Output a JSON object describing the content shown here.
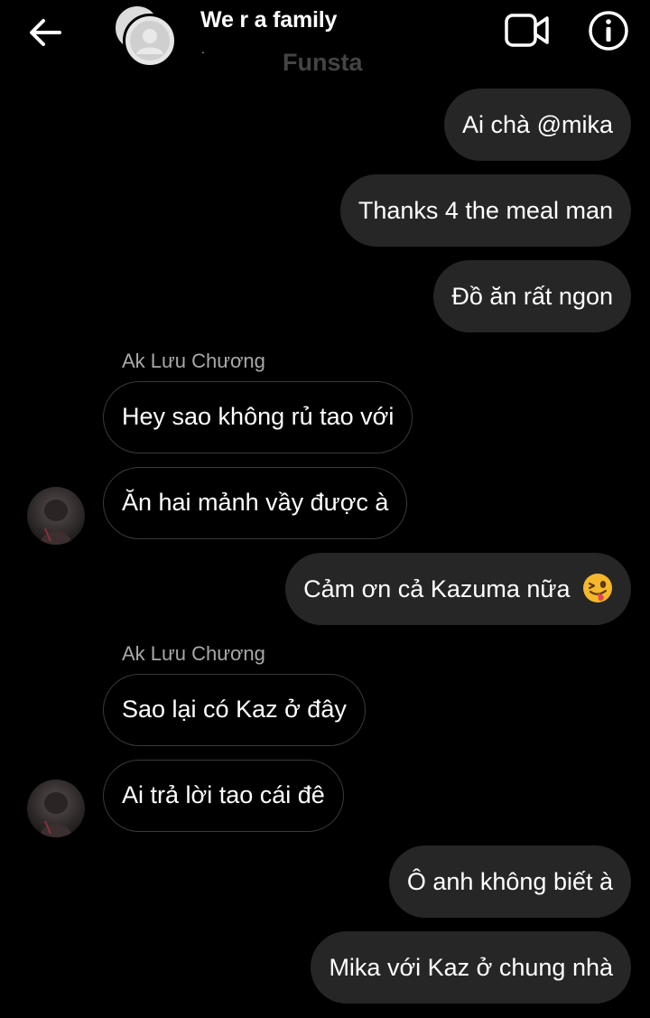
{
  "header": {
    "title": "We r a family",
    "dot": ".",
    "subtitle": "Funsta",
    "icons": {
      "back": "arrow-left-icon",
      "video": "video-camera-icon",
      "info": "info-icon"
    }
  },
  "messages": [
    {
      "side": "out",
      "text": "Ai chà @mika"
    },
    {
      "side": "out",
      "text": "Thanks 4 the meal man"
    },
    {
      "side": "out",
      "text": "Đồ ăn rất ngon"
    },
    {
      "side": "in",
      "sender": "Ak Lưu Chương",
      "text": "Hey sao không rủ tao với"
    },
    {
      "side": "in",
      "text": "Ăn hai mảnh vầy được à"
    },
    {
      "side": "out",
      "text": "Cảm ơn cả Kazuma nữa",
      "emoji": "winking-face-with-tongue"
    },
    {
      "side": "in",
      "sender": "Ak Lưu Chương",
      "text": "Sao lại có Kaz ở đây"
    },
    {
      "side": "in",
      "text": "Ai trả lời tao cái đê"
    },
    {
      "side": "out",
      "text": "Ô anh không biết à"
    },
    {
      "side": "out",
      "text": "Mika với Kaz ở chung nhà"
    }
  ],
  "colors": {
    "background": "#000000",
    "outgoing_bubble": "#262626",
    "incoming_border": "#3a3a3a",
    "sender_name": "#a8a8a8"
  }
}
